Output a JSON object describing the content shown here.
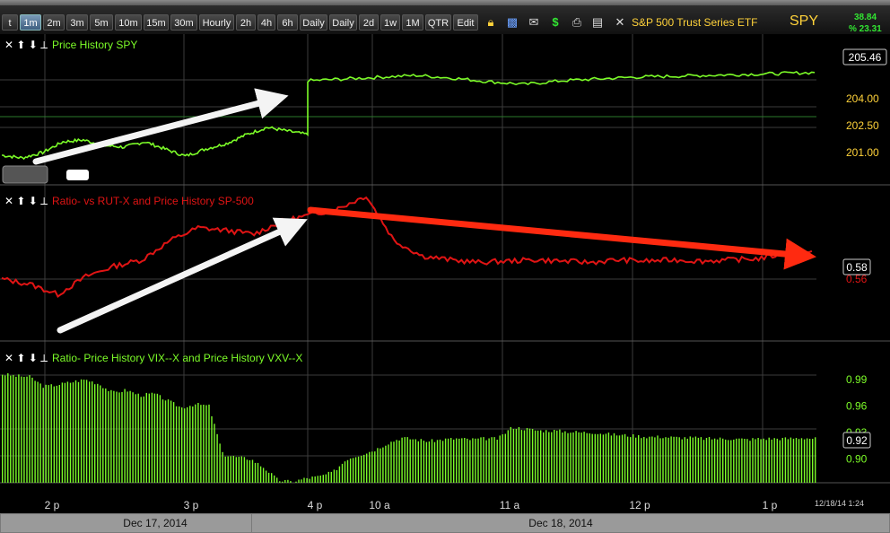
{
  "toolbar": {
    "buttons": [
      {
        "label": "t"
      },
      {
        "label": "1m",
        "active": true
      },
      {
        "label": "2m"
      },
      {
        "label": "3m"
      },
      {
        "label": "5m"
      },
      {
        "label": "10m"
      },
      {
        "label": "15m"
      },
      {
        "label": "30m"
      },
      {
        "label": "Hourly"
      },
      {
        "label": "2h"
      },
      {
        "label": "4h"
      },
      {
        "label": "6h"
      },
      {
        "label": "Daily"
      },
      {
        "label": "Daily"
      },
      {
        "label": "2d"
      },
      {
        "label": "1w"
      },
      {
        "label": "1M"
      },
      {
        "label": "QTR"
      },
      {
        "label": "Edit"
      }
    ],
    "icons": [
      "lock-icon",
      "save-icon",
      "mail-icon",
      "dollar-icon",
      "print-icon",
      "news-icon",
      "x-icon"
    ],
    "security_name": "S&P 500 Trust Series ETF",
    "symbol": "SPY",
    "quote_top": "38.84",
    "quote_bottom": "% 23.31"
  },
  "colors": {
    "green": "#7cfc28",
    "red": "#e01414",
    "grid": "#3c3c3c",
    "panel_bg": "#000000",
    "yellow": "#ffd23a"
  },
  "chart_data": [
    {
      "type": "line",
      "title": "Price History SPY",
      "x": [
        "2 p",
        "3 p",
        "4 p",
        "10 a",
        "11 a",
        "12 p",
        "1 p"
      ],
      "yticks": [
        204.0,
        202.5,
        201.0
      ],
      "ytick_labels": [
        "204.00",
        "202.50",
        "201.00"
      ],
      "last_value": "205.46",
      "series": [
        {
          "values": [
            200.85,
            200.7,
            201.0,
            201.6,
            201.7,
            201.4,
            201.3,
            201.6,
            201.2,
            200.8,
            201.2,
            201.5,
            202.0,
            202.4,
            202.2,
            202.0,
            205.0,
            205.1,
            205.2,
            205.3,
            205.15,
            204.95,
            204.8,
            205.0,
            205.1,
            205.2,
            205.25,
            205.3,
            205.35,
            205.4,
            205.46
          ]
        }
      ],
      "annotation": "white up arrow from 2 p to 4 p"
    },
    {
      "type": "line",
      "title": "Ratio-  vs RUT-X and  Price History SP-500",
      "yticks": [
        0.56
      ],
      "ytick_labels": [
        "0.56"
      ],
      "last_value": "0.58",
      "series": [
        {
          "values": [
            0.56,
            0.556,
            0.548,
            0.562,
            0.57,
            0.575,
            0.59,
            0.6,
            0.598,
            0.595,
            0.605,
            0.61,
            0.615,
            0.625,
            0.59,
            0.578,
            0.575,
            0.573,
            0.574,
            0.575,
            0.574,
            0.573,
            0.575,
            0.574,
            0.575,
            0.574,
            0.575,
            0.576,
            0.58,
            0.58
          ]
        }
      ],
      "annotations": [
        "white up arrow into 4 p",
        "red down arrow from 4 p to right edge"
      ]
    },
    {
      "type": "bar",
      "title": "Ratio-  Price History VIX--X and  Price History VXV--X",
      "yticks": [
        0.99,
        0.96,
        0.93,
        0.9
      ],
      "ytick_labels": [
        "0.99",
        "0.96",
        "0.93",
        "0.90"
      ],
      "ylim": [
        0.873,
        1.0
      ],
      "last_value": "0.92",
      "values": [
        0.996,
        0.994,
        0.993,
        0.982,
        0.984,
        0.987,
        0.99,
        0.985,
        0.975,
        0.978,
        0.972,
        0.974,
        0.966,
        0.958,
        0.962,
        0.96,
        0.905,
        0.902,
        0.9,
        0.89,
        0.876,
        0.874,
        0.878,
        0.88,
        0.885,
        0.9,
        0.905,
        0.91,
        0.918,
        0.924,
        0.922,
        0.92,
        0.922,
        0.923,
        0.922,
        0.923,
        0.923,
        0.936,
        0.934,
        0.932,
        0.932,
        0.931,
        0.93,
        0.93,
        0.928,
        0.927,
        0.926,
        0.925,
        0.925,
        0.924,
        0.924,
        0.923,
        0.923,
        0.923,
        0.922,
        0.923,
        0.923,
        0.923,
        0.924,
        0.923
      ]
    }
  ],
  "xaxis": {
    "ticks": [
      "2 p",
      "3 p",
      "4 p",
      "10 a",
      "11 a",
      "12 p",
      "1 p"
    ],
    "timestamp": "12/18/14 1:24",
    "dates": [
      "Dec 17, 2014",
      "Dec 18, 2014"
    ]
  }
}
